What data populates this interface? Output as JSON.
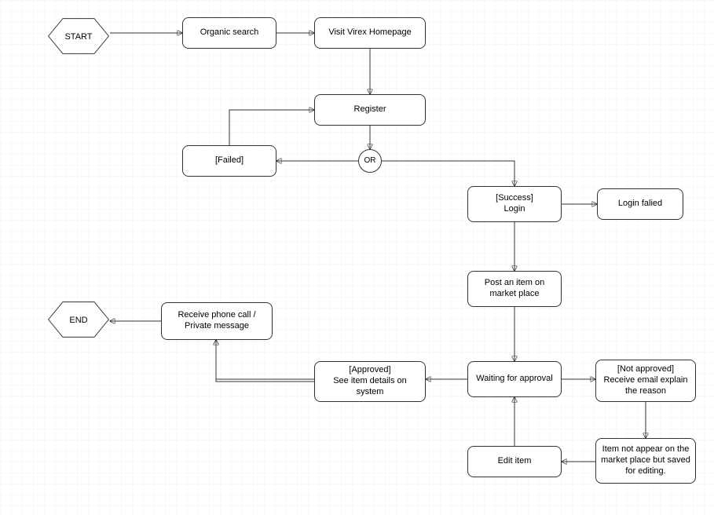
{
  "nodes": {
    "start": {
      "label": "START"
    },
    "organic_search": {
      "label": "Organic search"
    },
    "visit_homepage": {
      "label": "Visit Virex Homepage"
    },
    "register": {
      "label": "Register"
    },
    "or_gate": {
      "label": "OR"
    },
    "failed": {
      "label": "[Failed]"
    },
    "success_login": {
      "label": "[Success]\nLogin"
    },
    "login_failed": {
      "label": "Login falied"
    },
    "post_item": {
      "label": "Post an item on market place"
    },
    "waiting": {
      "label": "Waiting for approval"
    },
    "approved": {
      "label": "[Approved]\nSee item details on system"
    },
    "not_approved": {
      "label": "[Not approved]\nReceive email explain the reason"
    },
    "item_saved": {
      "label": "Item not appear on the market place but saved for editing."
    },
    "edit_item": {
      "label": "Edit item"
    },
    "receive_call": {
      "label": "Receive phone call / Private message"
    },
    "end": {
      "label": "END"
    }
  },
  "edges": [
    {
      "from": "start",
      "to": "organic_search"
    },
    {
      "from": "organic_search",
      "to": "visit_homepage"
    },
    {
      "from": "visit_homepage",
      "to": "register"
    },
    {
      "from": "register",
      "to": "or_gate"
    },
    {
      "from": "or_gate",
      "to": "failed"
    },
    {
      "from": "failed",
      "to": "register"
    },
    {
      "from": "or_gate",
      "to": "success_login"
    },
    {
      "from": "success_login",
      "to": "login_failed"
    },
    {
      "from": "success_login",
      "to": "post_item"
    },
    {
      "from": "post_item",
      "to": "waiting"
    },
    {
      "from": "waiting",
      "to": "approved"
    },
    {
      "from": "waiting",
      "to": "not_approved"
    },
    {
      "from": "not_approved",
      "to": "item_saved"
    },
    {
      "from": "item_saved",
      "to": "edit_item"
    },
    {
      "from": "edit_item",
      "to": "waiting"
    },
    {
      "from": "approved",
      "to": "receive_call"
    },
    {
      "from": "receive_call",
      "to": "end"
    }
  ]
}
